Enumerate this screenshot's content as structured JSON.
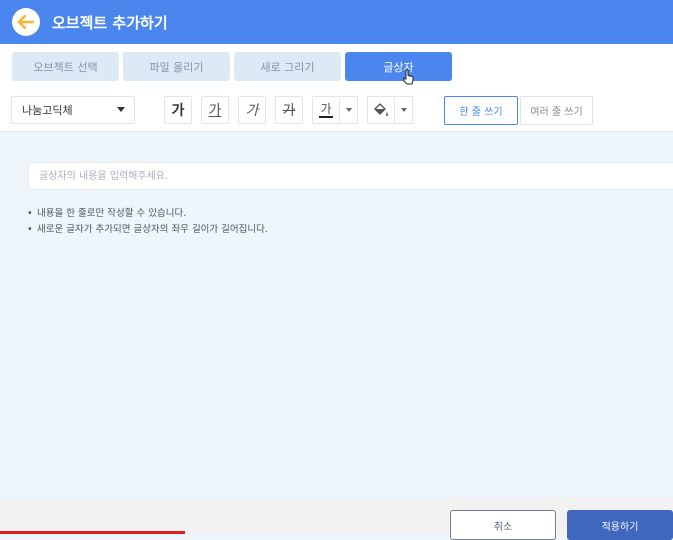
{
  "header": {
    "title": "오브젝트 추가하기"
  },
  "tabs": [
    {
      "label": "오브젝트 선택",
      "active": false
    },
    {
      "label": "파일 올리기",
      "active": false
    },
    {
      "label": "새로 그리기",
      "active": false
    },
    {
      "label": "글상자",
      "active": true
    }
  ],
  "toolbar": {
    "font": "나눔고딕체",
    "bold_label": "가",
    "underline_label": "가",
    "italic_label": "가",
    "strike_label": "가",
    "color_label": "가",
    "mode_single": "한 줄 쓰기",
    "mode_multi": "여러 줄 쓰기"
  },
  "input": {
    "placeholder": "글상자의 내용을 입력해주세요.",
    "value": ""
  },
  "notes": [
    "내용을 한 줄로만 작성할 수 있습니다.",
    "새로운 글자가 추가되면 글상자의 좌우 길이가 길어집니다."
  ],
  "footer": {
    "cancel": "취소",
    "apply": "적용하기"
  },
  "colors": {
    "primary": "#4b86ee",
    "apply_button": "#3e67bd",
    "accent_arrow": "#f5b731"
  },
  "icons": {
    "back": "arrow-left-icon",
    "fill": "paint-bucket-icon",
    "cursor": "mouse-pointer-icon"
  }
}
